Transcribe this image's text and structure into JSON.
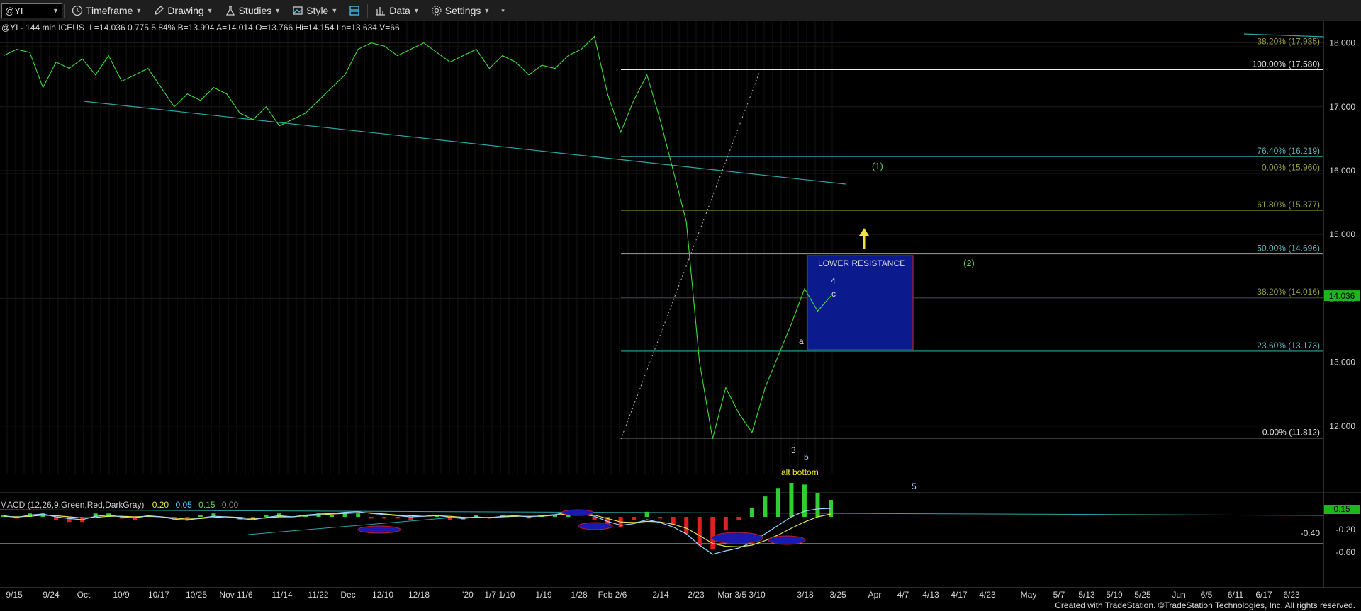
{
  "toolbar": {
    "symbol": "@YI",
    "items": [
      "Timeframe",
      "Drawing",
      "Studies",
      "Style",
      "Data",
      "Settings"
    ]
  },
  "header": {
    "symbol_line": "@YI - 144 min  ICEUS",
    "stats": "L=14.036  0.775  5.84%  B=13.994  A=14.014  O=13.766  Hi=14.154  Lo=13.634  V=66"
  },
  "macd_header": {
    "label": "MACD (12,26,9,Green,Red,DarkGray)",
    "values": [
      "0.20",
      "0.05",
      "0.15",
      "0.00"
    ],
    "value_colors": [
      "#e6e64c",
      "#4fc3f7",
      "#66d95a",
      "#888888"
    ]
  },
  "footer": "Created with TradeStation. ©TradeStation Technologies, Inc. All rights reserved.",
  "colors": {
    "fib_line": "#8a8f3a",
    "fib_teal": "#2aa6a6",
    "fib_white": "#e8e8e8",
    "fib_label": "#5fb8b8",
    "price": "#3ddc3d",
    "resistance_fill": "#0b1a8c",
    "resistance_border": "#c02020",
    "last_price_box": "#1fb51f"
  },
  "chart_data": [
    {
      "type": "line",
      "title": "@YI - 144 min ICEUS",
      "y_axis": {
        "ticks": [
          12.0,
          13.0,
          14.0,
          15.0,
          16.0,
          17.0,
          18.0
        ],
        "tick_labels": [
          "12.000",
          "13.000",
          "14.000",
          "15.000",
          "16.000",
          "17.000",
          "18.000"
        ],
        "ylim": [
          11.0,
          18.25
        ]
      },
      "x_axis": {
        "tick_labels": [
          "9/15",
          "9/24",
          "Oct",
          "10/9",
          "10/17",
          "10/25",
          "Nov 11/6",
          "11/14",
          "11/22",
          "Dec",
          "12/10",
          "12/18",
          "'20",
          "1/7 1/10",
          "1/19",
          "1/28",
          "Feb 2/6",
          "2/14",
          "2/23",
          "Mar 3/5 3/10",
          "3/18",
          "3/25",
          "Apr",
          "4/7",
          "4/13",
          "4/17",
          "4/23",
          "May",
          "5/7",
          "5/13",
          "5/19",
          "5/25",
          "Jun",
          "6/5",
          "6/11",
          "6/17",
          "6/23"
        ]
      },
      "series": [
        {
          "values": [
            17.8,
            17.9,
            17.85,
            17.3,
            17.7,
            17.6,
            17.75,
            17.5,
            17.8,
            17.4,
            17.5,
            17.6,
            17.3,
            17.0,
            17.2,
            17.1,
            17.3,
            17.2,
            16.9,
            16.8,
            17.0,
            16.7,
            16.8,
            16.9,
            17.1,
            17.3,
            17.5,
            17.9,
            18.0,
            17.95,
            17.8,
            17.9,
            18.0,
            17.85,
            17.7,
            17.8,
            17.9,
            17.6,
            17.8,
            17.7,
            17.5,
            17.65,
            17.6,
            17.8,
            17.9,
            18.1,
            17.2,
            16.6,
            17.1,
            17.5,
            16.8,
            16.0,
            15.2,
            13.0,
            11.8,
            12.6,
            12.2,
            11.9,
            12.6,
            13.1,
            13.6,
            14.15,
            13.8,
            14.036
          ]
        }
      ],
      "last_price": "14.036",
      "fib_levels": [
        {
          "label": "38.20% (17.935)",
          "value": 17.935
        },
        {
          "label": "100.00% (17.580)",
          "value": 17.58
        },
        {
          "label": "76.40% (16.219)",
          "value": 16.219
        },
        {
          "label": "0.00% (15.960)",
          "value": 15.96
        },
        {
          "label": "61.80% (15.377)",
          "value": 15.377
        },
        {
          "label": "50.00% (14.696)",
          "value": 14.696
        },
        {
          "label": "38.20% (14.016)",
          "value": 14.016
        },
        {
          "label": "23.60% (13.173)",
          "value": 13.173
        },
        {
          "label": "0.00% (11.812)",
          "value": 11.812
        }
      ],
      "annotations": [
        {
          "text": "LOWER RESISTANCE"
        },
        {
          "text": "(1)"
        },
        {
          "text": "(2)"
        },
        {
          "text": "4"
        },
        {
          "text": "c"
        },
        {
          "text": "a"
        },
        {
          "text": "3"
        },
        {
          "text": "b"
        },
        {
          "text": "alt bottom"
        },
        {
          "text": "5"
        }
      ]
    },
    {
      "type": "line",
      "title": "MACD (12,26,9,Green,Red,DarkGray)",
      "y_axis": {
        "tick_labels": [
          "0.15",
          "-0.20",
          "-0.40",
          "-0.60"
        ],
        "ylim": [
          -0.72,
          0.2
        ]
      },
      "series": [
        {
          "name": "MACD",
          "values": [
            0.02,
            -0.01,
            0.03,
            0.05,
            0.0,
            -0.03,
            -0.05,
            0.01,
            0.03,
            0.0,
            -0.02,
            0.02,
            0.0,
            -0.04,
            -0.06,
            -0.02,
            0.01,
            0.0,
            -0.03,
            -0.05,
            -0.01,
            0.02,
            0.0,
            0.03,
            0.05,
            0.06,
            0.08,
            0.09,
            0.06,
            0.04,
            0.02,
            0.0,
            0.01,
            0.03,
            -0.01,
            -0.03,
            0.0,
            -0.02,
            0.01,
            0.02,
            0.0,
            0.02,
            0.04,
            0.08,
            0.05,
            0.01,
            -0.08,
            -0.15,
            -0.12,
            -0.05,
            -0.1,
            -0.18,
            -0.3,
            -0.5,
            -0.66,
            -0.6,
            -0.55,
            -0.45,
            -0.3,
            -0.15,
            0.0,
            0.1,
            0.14,
            0.15
          ]
        },
        {
          "name": "Signal",
          "values": [
            0.01,
            0.0,
            0.01,
            0.03,
            0.02,
            0.0,
            -0.02,
            -0.01,
            0.01,
            0.01,
            0.0,
            0.01,
            0.0,
            -0.02,
            -0.04,
            -0.03,
            -0.01,
            0.0,
            -0.01,
            -0.03,
            -0.02,
            0.0,
            0.0,
            0.02,
            0.03,
            0.05,
            0.06,
            0.07,
            0.07,
            0.05,
            0.03,
            0.02,
            0.01,
            0.02,
            0.01,
            -0.01,
            -0.01,
            -0.01,
            0.0,
            0.01,
            0.01,
            0.01,
            0.03,
            0.05,
            0.05,
            0.03,
            -0.03,
            -0.09,
            -0.1,
            -0.08,
            -0.09,
            -0.13,
            -0.2,
            -0.33,
            -0.47,
            -0.52,
            -0.53,
            -0.5,
            -0.42,
            -0.32,
            -0.2,
            -0.09,
            0.0,
            0.05
          ]
        }
      ]
    }
  ]
}
